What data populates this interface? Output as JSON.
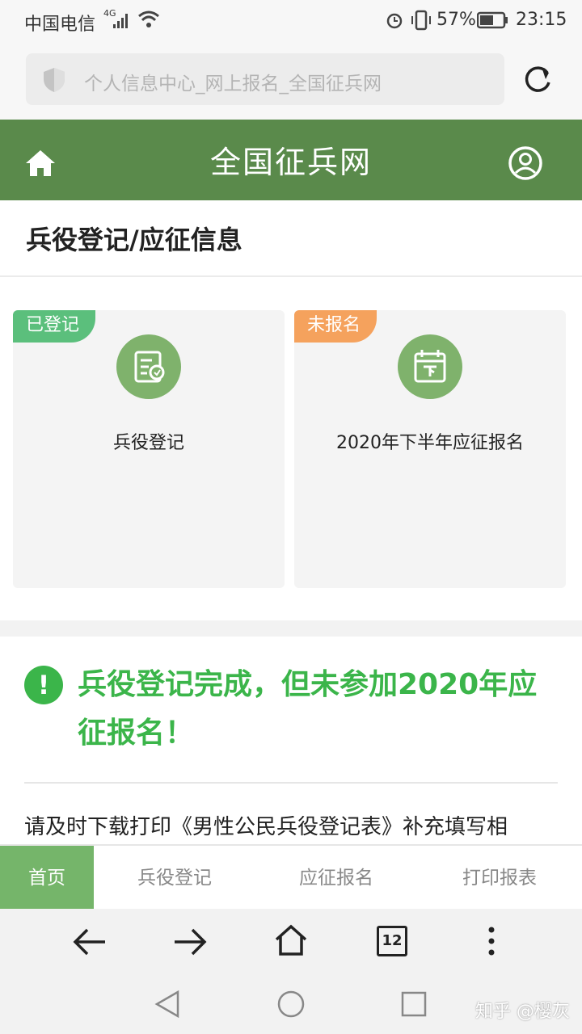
{
  "status_bar": {
    "carrier": "中国电信",
    "network": "4G",
    "battery": "57%",
    "time": "23:15"
  },
  "browser": {
    "url_placeholder": "个人信息中心_网上报名_全国征兵网",
    "tab_count": "12"
  },
  "header": {
    "title": "全国征兵网",
    "icons": [
      "home-icon",
      "user-icon"
    ]
  },
  "page": {
    "title": "兵役登记/应征信息"
  },
  "cards": [
    {
      "badge": "已登记",
      "badge_color": "#5bbf7c",
      "label": "兵役登记",
      "icon": "registration-form-icon"
    },
    {
      "badge": "未报名",
      "badge_color": "#f5a25d",
      "label": "2020年下半年应征报名",
      "icon": "calendar-down-icon"
    }
  ],
  "notice": {
    "message": "兵役登记完成，但未参加2020年应征报名！",
    "instruction": "请及时下载打印《男性公民兵役登记表》补充填写相",
    "color": "#3bb54a"
  },
  "site_tabs": [
    "首页",
    "兵役登记",
    "应征报名",
    "打印报表"
  ],
  "watermark": "知乎 @樱灰",
  "colors": {
    "header": "#5a8a4b",
    "active_tab": "#75b56a",
    "icon_circle": "#7fb26c"
  }
}
